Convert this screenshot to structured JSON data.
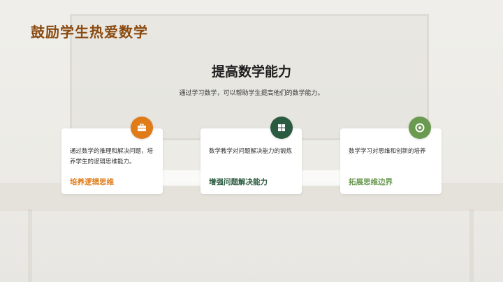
{
  "title": "鼓励学生热爱数学",
  "heading": "提高数学能力",
  "subtitle": "通过学习数学，可以帮助学生提高他们的数学能力。",
  "cards": [
    {
      "desc": "通过数学的推理和解决问题，培养学生的逻辑思维能力。",
      "label": "培养逻辑思维",
      "color": "#e07b1a",
      "icon": "briefcase-icon"
    },
    {
      "desc": "数学教学对问题解决能力的锻炼",
      "label": "增强问题解决能力",
      "color": "#2a5a3f",
      "icon": "puzzle-icon"
    },
    {
      "desc": "数学学习对思维和创新的培养",
      "label": "拓展思维边界",
      "color": "#6a9a50",
      "icon": "target-icon"
    }
  ]
}
